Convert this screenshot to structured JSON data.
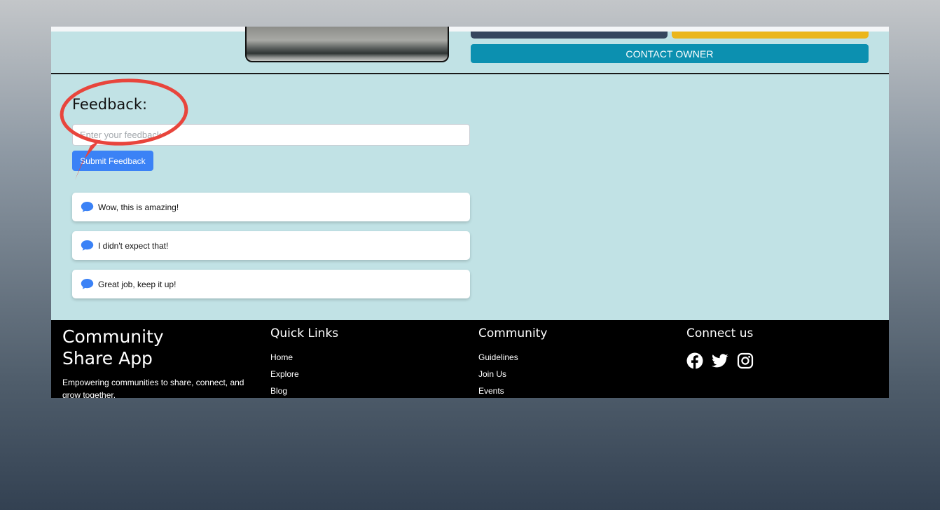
{
  "product": {
    "contact_owner_label": "CONTACT OWNER"
  },
  "feedback": {
    "heading": "Feedback:",
    "input_placeholder": "Enter your feedback",
    "input_value": "",
    "submit_label": "Submit Feedback",
    "items": [
      {
        "text": "Wow, this is amazing!",
        "icon": "chat-bubble-icon"
      },
      {
        "text": "I didn't expect that!",
        "icon": "chat-bubble-icon"
      },
      {
        "text": "Great job, keep it up!",
        "icon": "chat-bubble-icon"
      }
    ]
  },
  "footer": {
    "brand_line1": "Community",
    "brand_line2": "Share App",
    "tagline": "Empowering communities to share, connect, and grow together.",
    "quick_links": {
      "title": "Quick Links",
      "links": [
        "Home",
        "Explore",
        "Blog"
      ]
    },
    "community": {
      "title": "Community",
      "links": [
        "Guidelines",
        "Join Us",
        "Events"
      ]
    },
    "connect": {
      "title": "Connect us",
      "icons": [
        "facebook-icon",
        "twitter-icon",
        "instagram-icon"
      ]
    }
  },
  "colors": {
    "content_background": "#c1e2e5",
    "contact_button": "#0c90b0",
    "submit_button": "#3b82f6",
    "accent_yellow": "#ebb61b",
    "accent_dark": "#36465e",
    "footer_background": "#000000",
    "annotation_red": "#e8453c"
  }
}
